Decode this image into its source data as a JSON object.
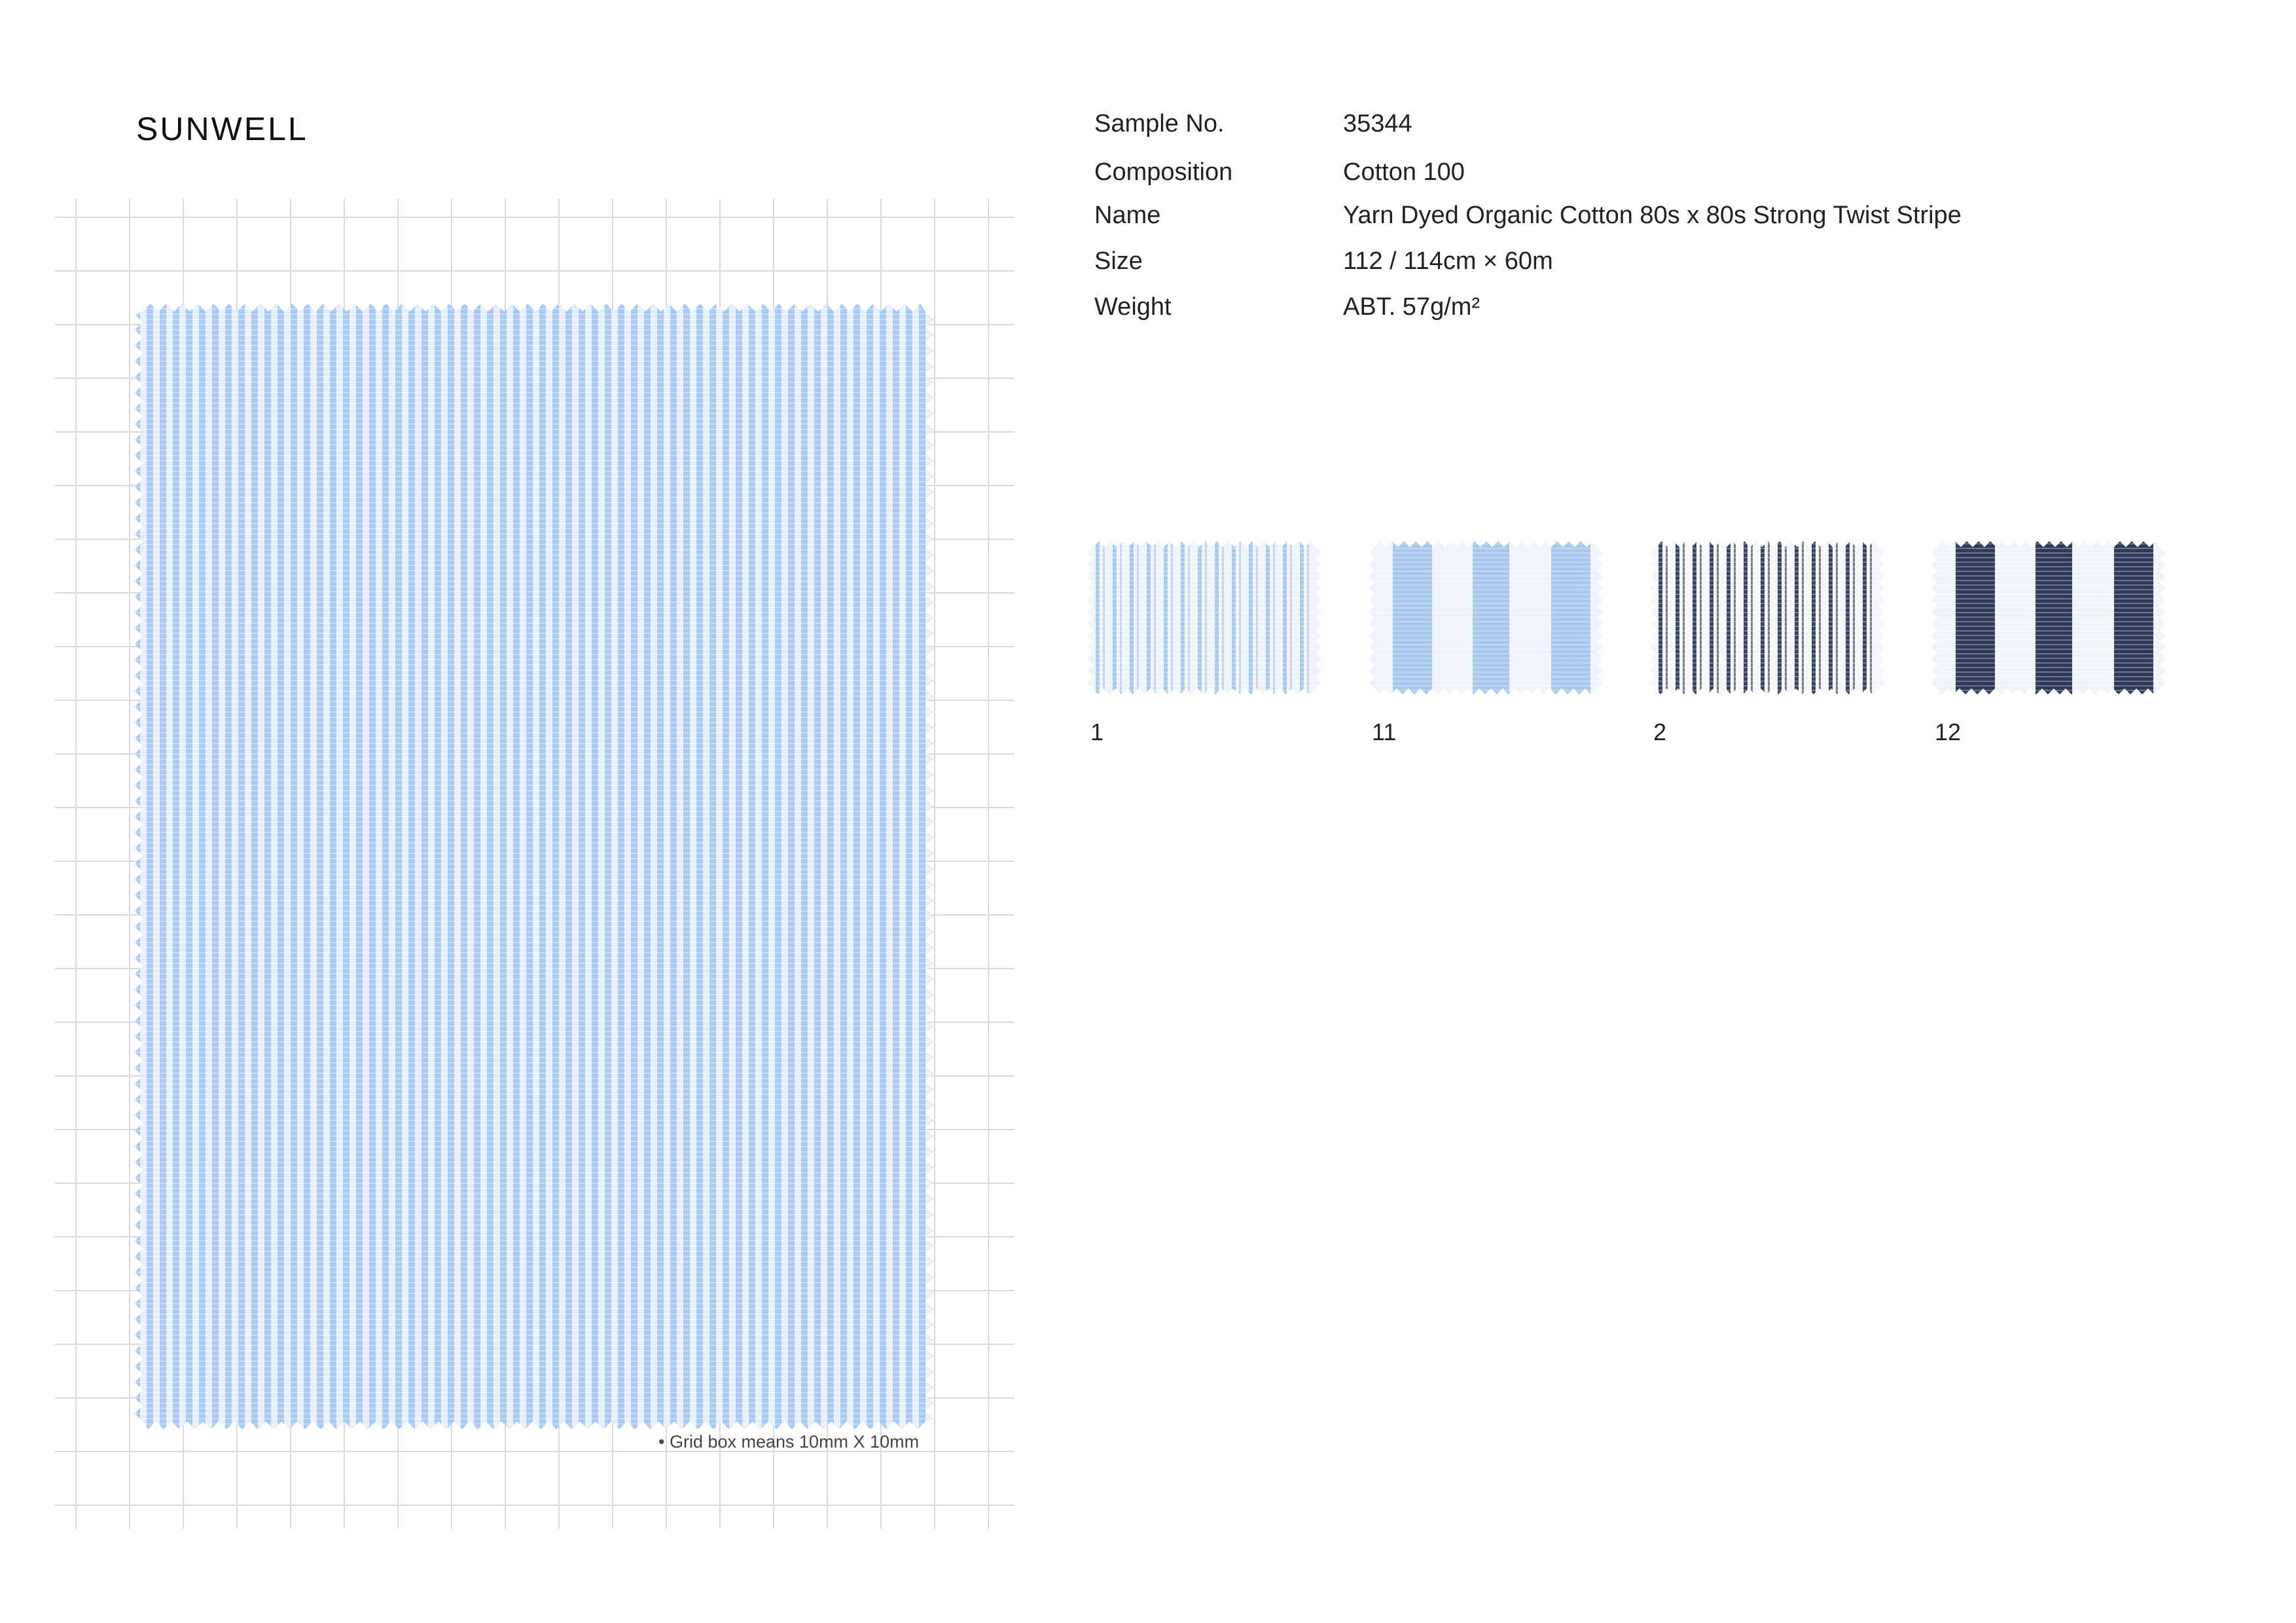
{
  "brand": "SUNWELL",
  "specs": [
    {
      "label": "Sample No.",
      "value": "35344"
    },
    {
      "label": "Composition",
      "value": "Cotton 100"
    },
    {
      "label": "Name",
      "value": "Yarn Dyed Organic Cotton 80s x 80s Strong Twist  Stripe"
    },
    {
      "label": "Size",
      "value": "112 / 114cm × 60m"
    },
    {
      "label": "Weight",
      "value": "ABT. 57g/m²"
    }
  ],
  "grid_note": "• Grid box means 10mm X 10mm",
  "swatches": [
    {
      "label": "1",
      "ground": "#eef4fc",
      "stripe": "#a9c8ee",
      "pattern": "fine"
    },
    {
      "label": "11",
      "ground": "#eef4fc",
      "stripe": "#a9c8ee",
      "pattern": "wide"
    },
    {
      "label": "2",
      "ground": "#f3f5f9",
      "stripe": "#3a4563",
      "pattern": "fine"
    },
    {
      "label": "12",
      "ground": "#eef3fa",
      "stripe": "#2f3a5a",
      "pattern": "wide"
    }
  ],
  "colors": {
    "grid_line": "#d9d9d9",
    "main_ground": "#e4effb",
    "main_stripe": "#9ec3ef"
  }
}
